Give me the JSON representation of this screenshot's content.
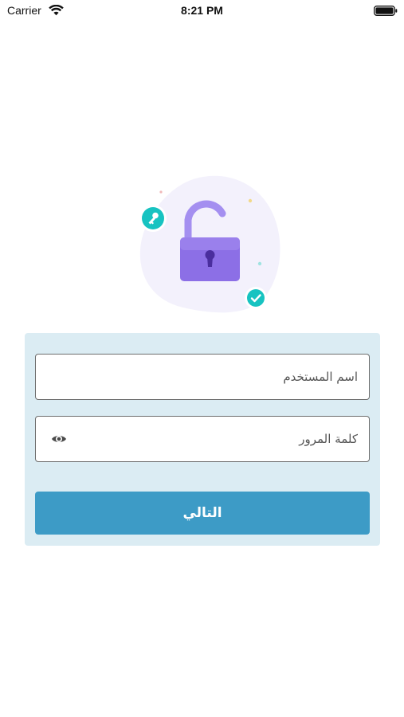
{
  "status_bar": {
    "carrier": "Carrier",
    "time": "8:21 PM"
  },
  "illustration": {
    "icons": [
      "lock-open-icon",
      "key-icon",
      "check-icon"
    ],
    "colors": {
      "blob": "#f3f1fc",
      "lock_body": "#8c6fe6",
      "shackle": "#a48ff0",
      "badge": "#17c3c1"
    }
  },
  "login_form": {
    "username_placeholder": "اسم المستخدم",
    "username_value": "",
    "password_placeholder": "كلمة المرور",
    "password_value": "",
    "next_label": "التالي"
  },
  "colors": {
    "card_background": "#dbecf3",
    "button_background": "#3d9bc6",
    "button_text": "#ffffff"
  }
}
